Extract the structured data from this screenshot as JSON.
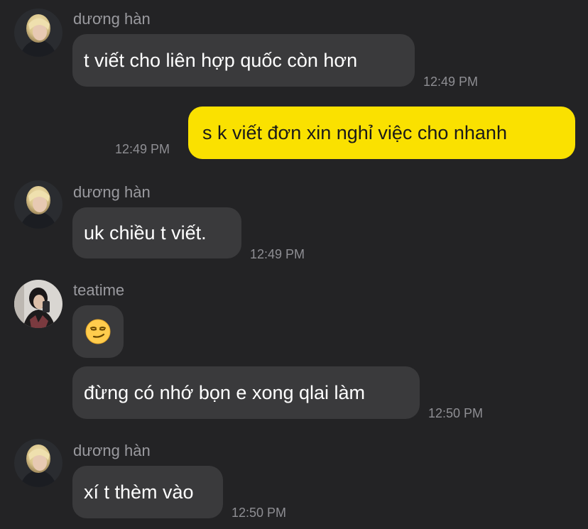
{
  "messages": [
    {
      "sender": "dương hàn",
      "bubbles": [
        {
          "text": "t viết cho liên hợp quốc còn hơn",
          "time": "12:49 PM"
        }
      ]
    },
    {
      "sender": "me",
      "bubbles": [
        {
          "text": "s k viết đơn xin nghỉ việc cho nhanh",
          "time": "12:49 PM"
        }
      ]
    },
    {
      "sender": "dương hàn",
      "bubbles": [
        {
          "text": "uk chiều t viết.",
          "time": "12:49 PM"
        }
      ]
    },
    {
      "sender": "teatime",
      "bubbles": [
        {
          "emoji": "smirking-face-emoji"
        },
        {
          "text": "đừng có nhớ bọn e xong qlai làm",
          "time": "12:50 PM"
        }
      ]
    },
    {
      "sender": "dương hàn",
      "bubbles": [
        {
          "text": "xí t thèm vào",
          "time": "12:50 PM"
        }
      ]
    }
  ],
  "colors": {
    "background": "#232325",
    "incoming_bubble": "#3a3a3c",
    "outgoing_bubble": "#fae100",
    "sender_name": "#9a9a9f",
    "timestamp": "#8e8e93"
  }
}
